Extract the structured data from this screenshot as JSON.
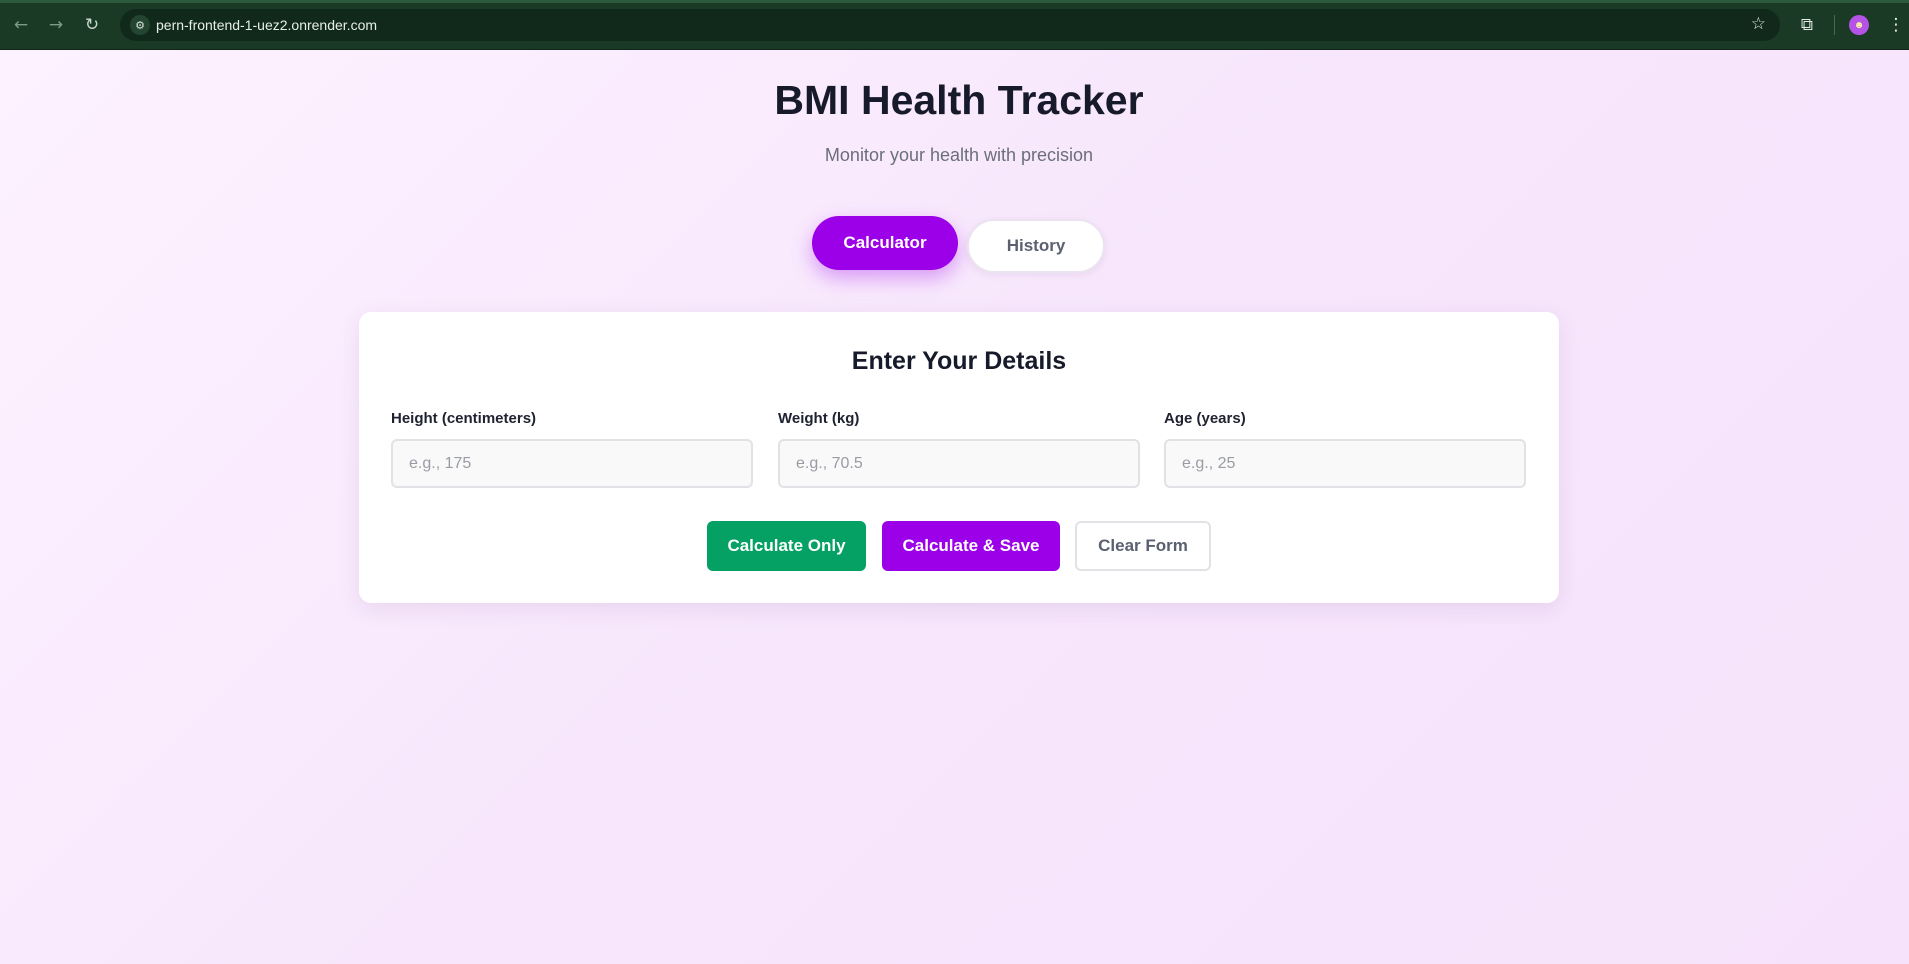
{
  "browser": {
    "url": "pern-frontend-1-uez2.onrender.com",
    "icons": {
      "back": "arrow-left-icon",
      "forward": "arrow-right-icon",
      "reload": "reload-icon",
      "site_info": "tune-icon",
      "bookmark": "star-icon",
      "extensions": "puzzle-icon",
      "menu": "kebab-menu-icon"
    }
  },
  "header": {
    "title": "BMI Health Tracker",
    "subtitle": "Monitor your health with precision"
  },
  "tabs": [
    {
      "label": "Calculator",
      "active": true
    },
    {
      "label": "History",
      "active": false
    }
  ],
  "form": {
    "title": "Enter Your Details",
    "fields": [
      {
        "label": "Height (centimeters)",
        "value": "",
        "placeholder": "e.g., 175"
      },
      {
        "label": "Weight (kg)",
        "value": "",
        "placeholder": "e.g., 70.5"
      },
      {
        "label": "Age (years)",
        "value": "",
        "placeholder": "e.g., 25"
      }
    ],
    "buttons": {
      "calculate_only": "Calculate Only",
      "calculate_save": "Calculate & Save",
      "clear": "Clear Form"
    }
  },
  "colors": {
    "accent_purple": "#9b00e8",
    "accent_green": "#04a064",
    "page_background": "#f8e9ff"
  }
}
